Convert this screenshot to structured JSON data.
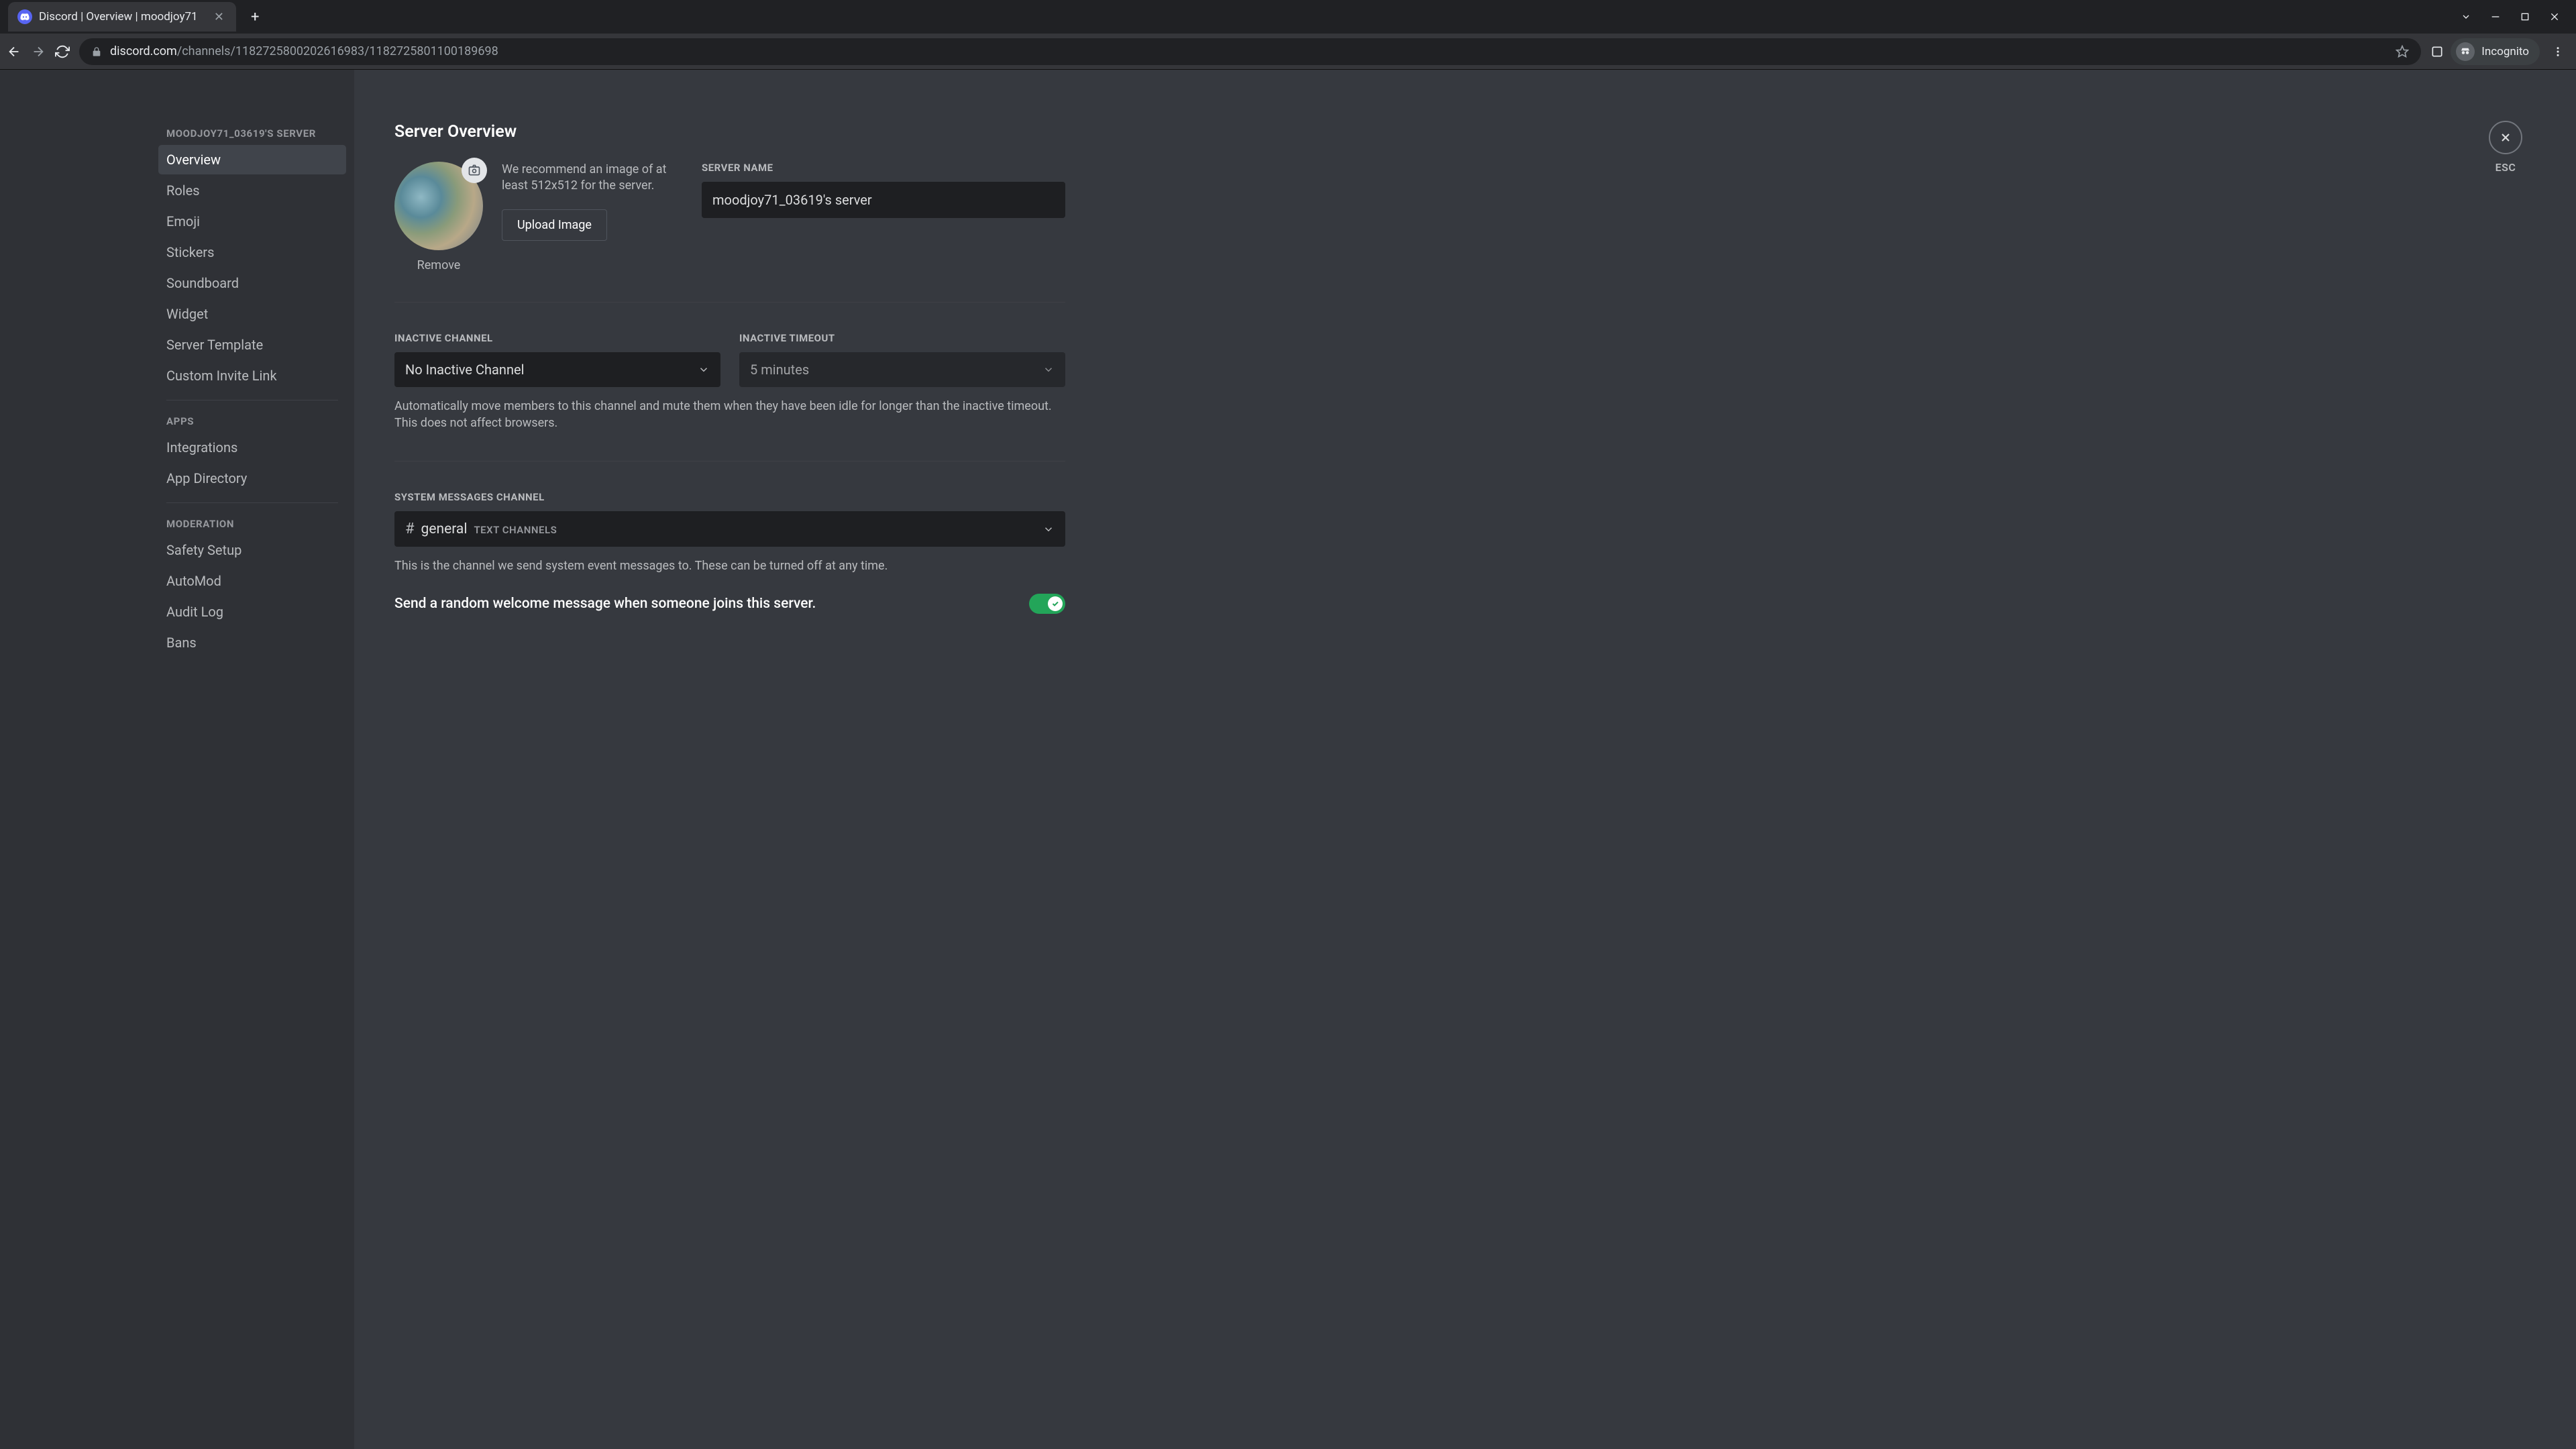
{
  "browser": {
    "tab_title": "Discord | Overview | moodjoy71",
    "url_domain": "discord.com",
    "url_path": "/channels/1182725800202616983/1182725801100189698",
    "incognito_label": "Incognito"
  },
  "sidebar": {
    "server_heading": "MOODJOY71_03619'S SERVER",
    "items_main": [
      {
        "label": "Overview",
        "active": true
      },
      {
        "label": "Roles"
      },
      {
        "label": "Emoji"
      },
      {
        "label": "Stickers"
      },
      {
        "label": "Soundboard"
      },
      {
        "label": "Widget"
      },
      {
        "label": "Server Template"
      },
      {
        "label": "Custom Invite Link"
      }
    ],
    "apps_heading": "APPS",
    "items_apps": [
      {
        "label": "Integrations"
      },
      {
        "label": "App Directory"
      }
    ],
    "moderation_heading": "MODERATION",
    "items_moderation": [
      {
        "label": "Safety Setup"
      },
      {
        "label": "AutoMod"
      },
      {
        "label": "Audit Log"
      },
      {
        "label": "Bans"
      }
    ]
  },
  "content": {
    "title": "Server Overview",
    "close_label": "ESC",
    "icon_recommend": "We recommend an image of at least 512x512 for the server.",
    "upload_button": "Upload Image",
    "remove_link": "Remove",
    "server_name_label": "SERVER NAME",
    "server_name_value": "moodjoy71_03619's server",
    "inactive_channel_label": "INACTIVE CHANNEL",
    "inactive_channel_value": "No Inactive Channel",
    "inactive_timeout_label": "INACTIVE TIMEOUT",
    "inactive_timeout_value": "5 minutes",
    "inactive_help": "Automatically move members to this channel and mute them when they have been idle for longer than the inactive timeout. This does not affect browsers.",
    "system_channel_label": "SYSTEM MESSAGES CHANNEL",
    "system_channel_name": "general",
    "system_channel_category": "TEXT CHANNELS",
    "system_channel_help": "This is the channel we send system event messages to. These can be turned off at any time.",
    "welcome_toggle_label": "Send a random welcome message when someone joins this server."
  }
}
